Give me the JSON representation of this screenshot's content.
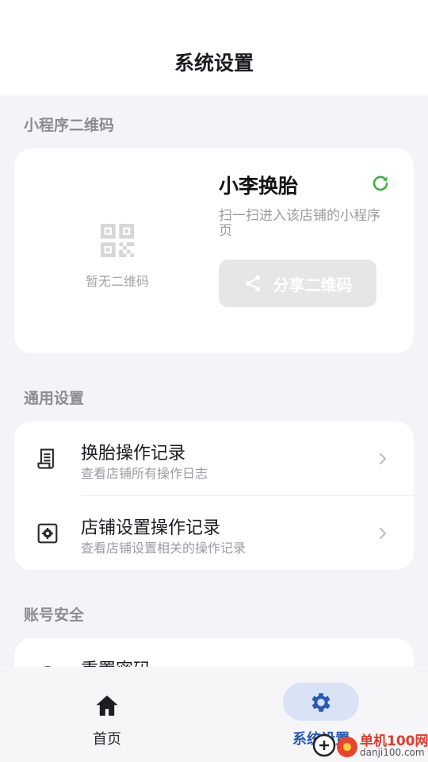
{
  "header": {
    "title": "系统设置"
  },
  "qr_section": {
    "label": "小程序二维码",
    "empty_text": "暂无二维码",
    "shop_name": "小李换胎",
    "description": "扫一扫进入该店铺的小程序页",
    "share_label": "分享二维码"
  },
  "general_section": {
    "label": "通用设置",
    "items": [
      {
        "title": "换胎操作记录",
        "subtitle": "查看店铺所有操作日志"
      },
      {
        "title": "店铺设置操作记录",
        "subtitle": "查看店铺设置相关的操作记录"
      }
    ]
  },
  "security_section": {
    "label": "账号安全",
    "items": [
      {
        "title": "重置密码"
      }
    ]
  },
  "bottom_nav": {
    "items": [
      {
        "label": "首页",
        "active": false
      },
      {
        "label": "系统设置",
        "active": true
      }
    ]
  },
  "watermark": {
    "name": "单机100网",
    "url": "danji100.com"
  },
  "colors": {
    "accent": "#2a5bb8",
    "refresh": "#3cb043",
    "active_pill": "#d9e3f5"
  }
}
